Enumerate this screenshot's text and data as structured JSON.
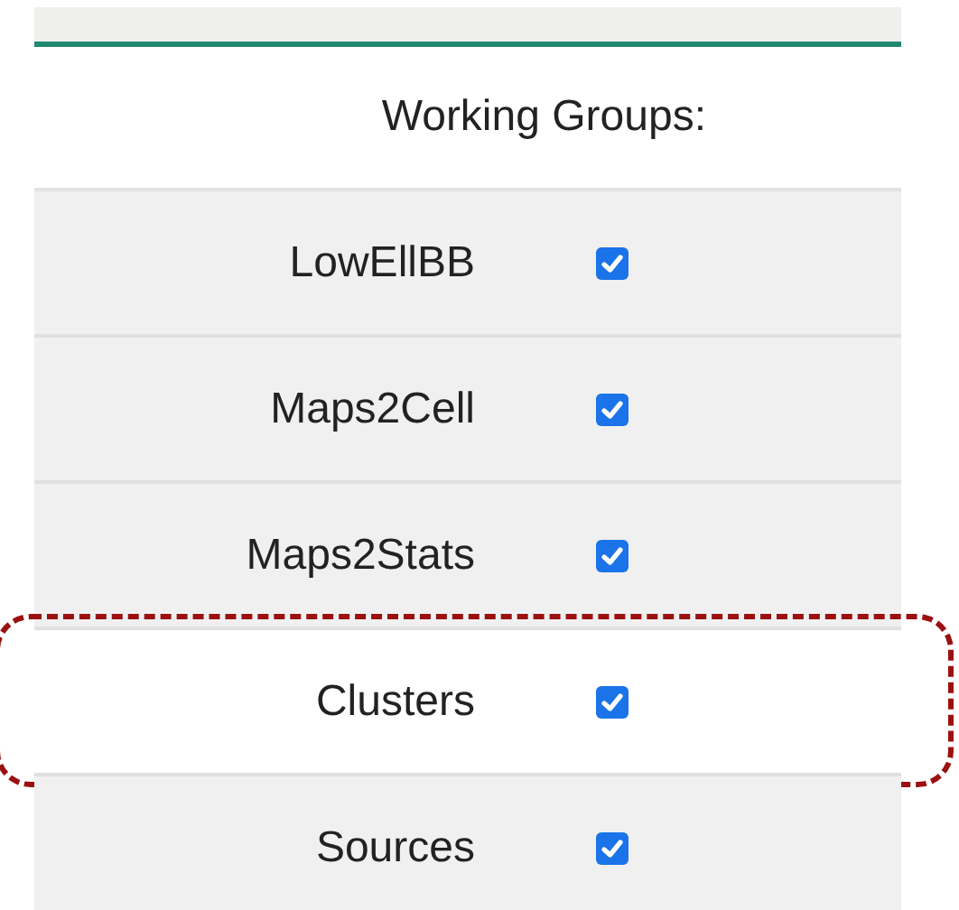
{
  "header": "Working Groups:",
  "rows": [
    {
      "label": "LowEllBB",
      "checked": true,
      "highlighted": false
    },
    {
      "label": "Maps2Cell",
      "checked": true,
      "highlighted": false
    },
    {
      "label": "Maps2Stats",
      "checked": true,
      "highlighted": false
    },
    {
      "label": "Clusters",
      "checked": true,
      "highlighted": true
    },
    {
      "label": "Sources",
      "checked": true,
      "highlighted": false
    }
  ]
}
